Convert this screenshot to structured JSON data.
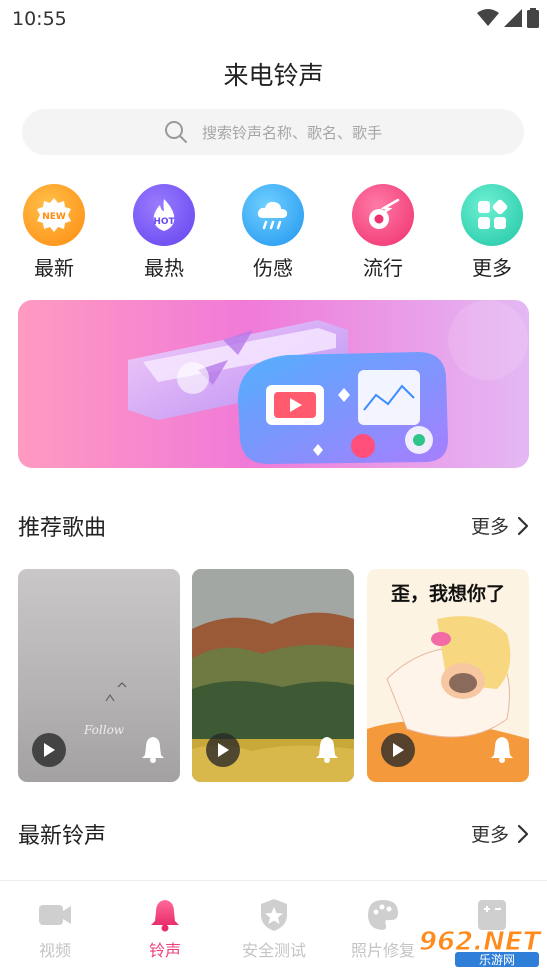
{
  "status_bar": {
    "time": "10:55"
  },
  "header": {
    "title": "来电铃声"
  },
  "search": {
    "placeholder": "搜索铃声名称、歌名、歌手"
  },
  "categories": [
    {
      "label": "最新",
      "icon": "new-badge-icon",
      "color": "#ff9a1f"
    },
    {
      "label": "最热",
      "icon": "hot-flame-icon",
      "color": "#7a5cf5"
    },
    {
      "label": "伤感",
      "icon": "rain-cloud-icon",
      "color": "#2ea8f5"
    },
    {
      "label": "流行",
      "icon": "comet-icon",
      "color": "#f5457e"
    },
    {
      "label": "更多",
      "icon": "grid-apps-icon",
      "color": "#2ed3b2"
    }
  ],
  "recommended": {
    "title": "推荐歌曲",
    "more": "更多",
    "cards": [
      {
        "caption": "Follow"
      },
      {
        "caption": ""
      },
      {
        "caption": "歪，我想你了"
      }
    ]
  },
  "latest": {
    "title": "最新铃声",
    "more": "更多"
  },
  "tabs": [
    {
      "label": "视频",
      "icon": "video-camera-icon",
      "active": false
    },
    {
      "label": "铃声",
      "icon": "bell-icon",
      "active": true
    },
    {
      "label": "安全测试",
      "icon": "shield-star-icon",
      "active": false
    },
    {
      "label": "照片修复",
      "icon": "palette-icon",
      "active": false
    },
    {
      "label": "",
      "icon": "calculator-icon",
      "active": false
    }
  ],
  "watermark": {
    "brand": "962.NET",
    "sub": "乐游网"
  },
  "colors": {
    "accent": "#f0407a",
    "inactive": "#c4c4c4"
  }
}
